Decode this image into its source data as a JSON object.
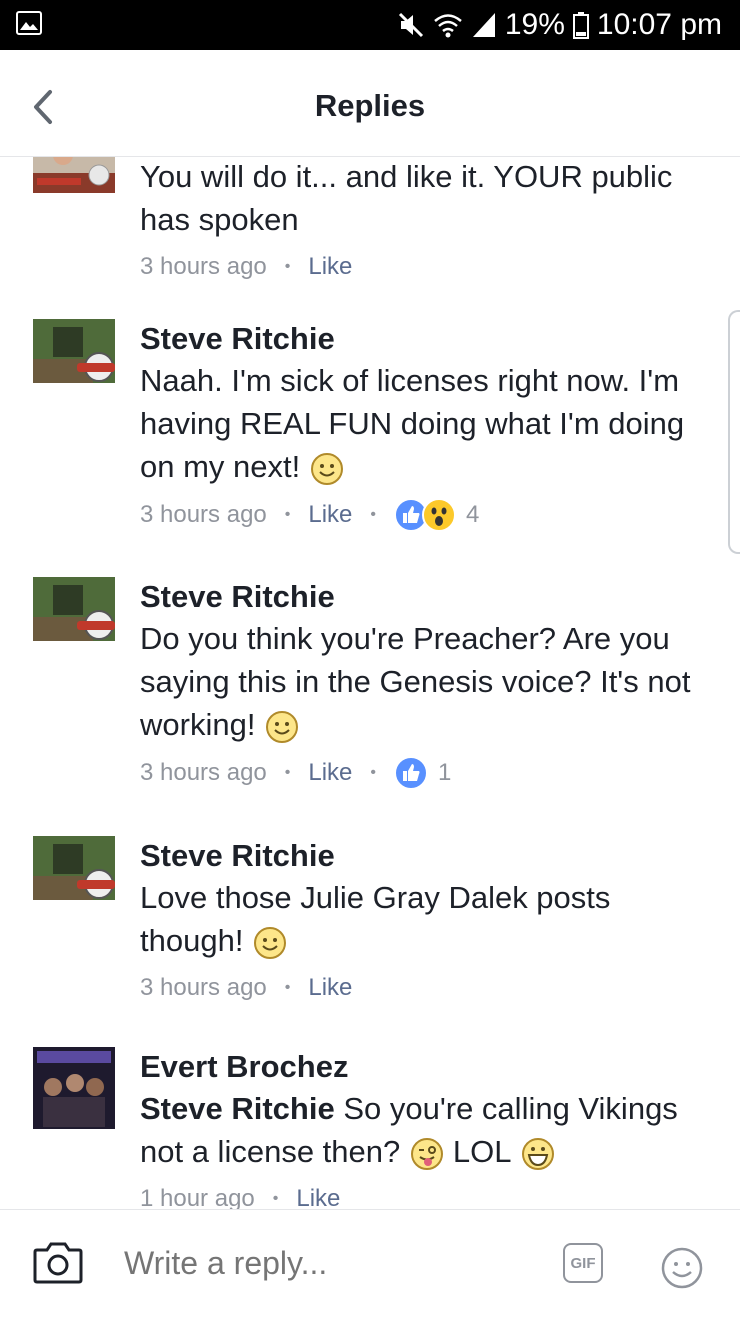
{
  "status": {
    "battery": "19%",
    "time": "10:07 pm"
  },
  "header": {
    "title": "Replies"
  },
  "comments": [
    {
      "author": "",
      "text": "You will do it... and like it. YOUR public has spoken",
      "time": "3 hours ago",
      "like": "Like"
    },
    {
      "author": "Steve Ritchie",
      "text": "Naah.  I'm sick of licenses right now. I'm having REAL FUN doing what I'm doing on my next!",
      "time": "3 hours ago",
      "like": "Like",
      "reaction_count": "4"
    },
    {
      "author": "Steve Ritchie",
      "text": "Do you think you're Preacher?  Are you saying this in the Genesis voice?  It's not working!",
      "time": "3 hours ago",
      "like": "Like",
      "reaction_count": "1"
    },
    {
      "author": "Steve Ritchie",
      "text": "Love those Julie Gray Dalek posts though!",
      "time": "3 hours ago",
      "like": "Like"
    },
    {
      "author": "Evert Brochez",
      "tag": "Steve Ritchie",
      "text": "So you're calling Vikings not a license then?",
      "text_after": "LOL",
      "time": "1 hour ago",
      "like": "Like"
    }
  ],
  "composer": {
    "placeholder": "Write a reply...",
    "gif": "GIF"
  },
  "icons": [
    "image-icon",
    "mute-icon",
    "wifi-icon",
    "signal-icon",
    "battery-icon",
    "back-icon",
    "camera-icon",
    "gif-icon",
    "smiley-icon",
    "like-reaction-icon",
    "wow-reaction-icon"
  ],
  "colors": {
    "accent": "#4267b2",
    "like_blue": "#5890ff",
    "meta_gray": "#90949c"
  }
}
